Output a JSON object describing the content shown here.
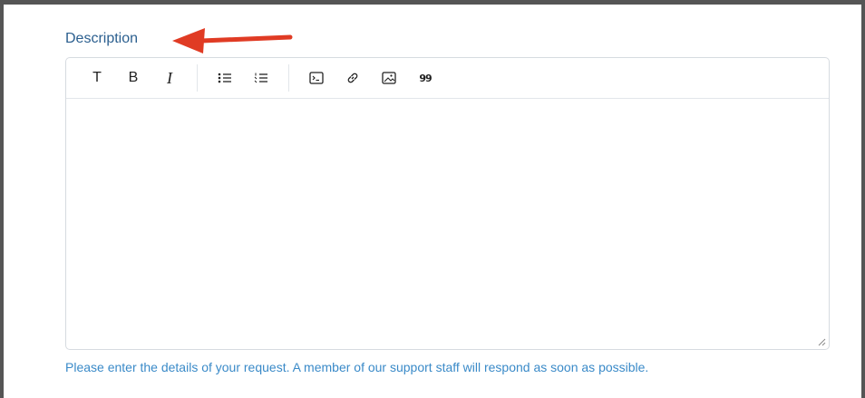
{
  "field": {
    "label": "Description",
    "help_text": "Please enter the details of your request. A member of our support staff will respond as soon as possible."
  },
  "toolbar": {
    "text_style_label": "T",
    "bold_label": "B",
    "italic_label": "I",
    "quote_label": "99"
  },
  "editor": {
    "value": ""
  },
  "colors": {
    "label": "#2b5f8f",
    "help_text": "#3a8ac8",
    "annotation_arrow": "#e03b24",
    "border": "#d6dbe0"
  },
  "icons": [
    "bulleted-list-icon",
    "numbered-list-icon",
    "code-icon",
    "link-icon",
    "image-icon",
    "quote-icon",
    "resize-handle-icon",
    "annotation-arrow-icon"
  ]
}
